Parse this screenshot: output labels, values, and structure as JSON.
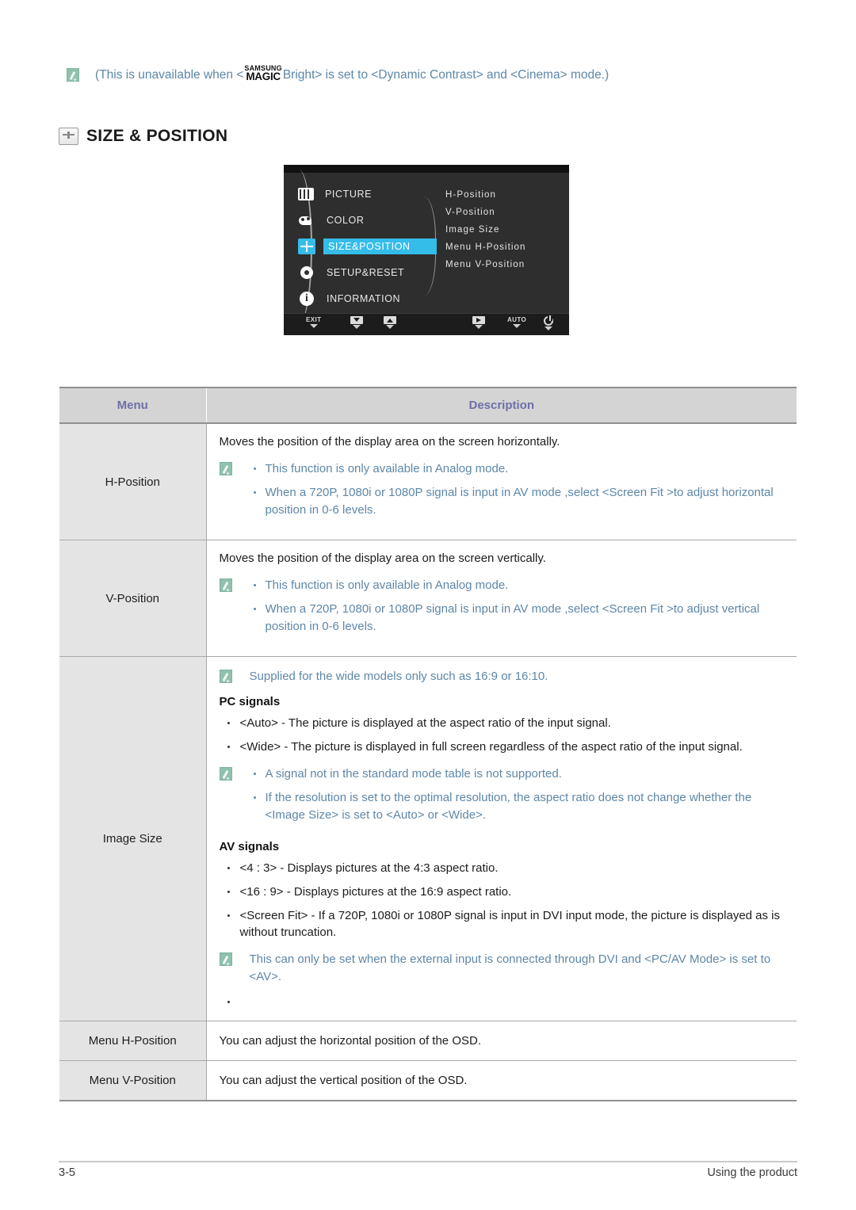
{
  "top_note": {
    "icon": "note-icon",
    "text_before": "(This is unavailable when <",
    "logo_line1": "SAMSUNG",
    "logo_line2": "MAGIC",
    "text_after": "Bright> is set to <Dynamic Contrast> and <Cinema> mode.)"
  },
  "heading": {
    "icon": "size-position-icon",
    "title": "SIZE & POSITION"
  },
  "osd": {
    "left_menu": [
      {
        "icon": "picture-icon",
        "label": "PICTURE",
        "active": false
      },
      {
        "icon": "color-icon",
        "label": "COLOR",
        "active": false
      },
      {
        "icon": "size-position-icon",
        "label": "SIZE&POSITION",
        "active": true
      },
      {
        "icon": "setup-reset-icon",
        "label": "SETUP&RESET",
        "active": false
      },
      {
        "icon": "information-icon",
        "label": "INFORMATION",
        "active": false
      }
    ],
    "submenu": [
      "H-Position",
      "V-Position",
      "Image Size",
      "Menu H-Position",
      "Menu V-Position"
    ],
    "buttons": [
      {
        "name": "exit-button",
        "label": "EXIT",
        "glyph": "text"
      },
      {
        "name": "down-button",
        "label": "",
        "glyph": "down"
      },
      {
        "name": "up-button",
        "label": "",
        "glyph": "up"
      },
      {
        "name": "enter-button",
        "label": "",
        "glyph": "play"
      },
      {
        "name": "auto-button",
        "label": "AUTO",
        "glyph": "text"
      },
      {
        "name": "power-button",
        "label": "",
        "glyph": "power"
      }
    ],
    "highlight_color": "#35bdea"
  },
  "table": {
    "headers": {
      "menu": "Menu",
      "description": "Description"
    },
    "rows": [
      {
        "menu": "H-Position",
        "lead": "Moves the position of the display area on the screen horizontally.",
        "note_bullets": [
          "This function is only available in Analog mode.",
          "When a 720P, 1080i or 1080P signal is input in AV mode ,select <Screen Fit  >to adjust horizontal position in 0-6 levels."
        ]
      },
      {
        "menu": "V-Position",
        "lead": "Moves the position of the display area on the screen vertically.",
        "note_bullets": [
          "This function is only available in Analog mode.",
          "When a 720P, 1080i or 1080P signal is input in AV mode ,select <Screen Fit  >to adjust vertical position in 0-6 levels."
        ]
      },
      {
        "menu": "Image Size",
        "note_top": "Supplied for the wide models only such as 16:9 or 16:10.",
        "pc_heading": "PC signals",
        "pc_bullets": [
          "<Auto> - The picture is displayed at the aspect ratio of the input signal.",
          "<Wide> - The picture is displayed in full screen regardless of the aspect ratio of the input signal."
        ],
        "pc_note_bullets": [
          "A signal not in the standard mode table is not supported.",
          "If the resolution is set to the optimal resolution, the aspect ratio does not change whether the <Image Size> is set to <Auto> or <Wide>."
        ],
        "av_heading": "AV signals",
        "av_bullets": [
          "<4 : 3> - Displays pictures at the 4:3 aspect ratio.",
          "<16 : 9> - Displays pictures at the 16:9 aspect ratio.",
          "<Screen Fit> - If a 720P, 1080i or 1080P signal is input in DVI input mode, the picture is displayed as is without truncation."
        ],
        "av_note": "This can only be set when the external input is connected through DVI and <PC/AV Mode> is set to <AV>."
      },
      {
        "menu": "Menu H-Position",
        "lead": "You can adjust the horizontal position of the OSD."
      },
      {
        "menu": "Menu V-Position",
        "lead": "You can adjust the vertical position of the OSD."
      }
    ]
  },
  "footer": {
    "page_number": "3-5",
    "section": "Using the product"
  },
  "colors": {
    "note_text": "#5d87a8",
    "note_icon_bg": "#8fc1ad",
    "table_header_bg": "#d4d4d4",
    "table_header_text": "#6f6fa8",
    "menu_cell_bg": "#e4e4e4",
    "osd_bg": "#2e2e2e",
    "osd_highlight": "#35bdea"
  }
}
